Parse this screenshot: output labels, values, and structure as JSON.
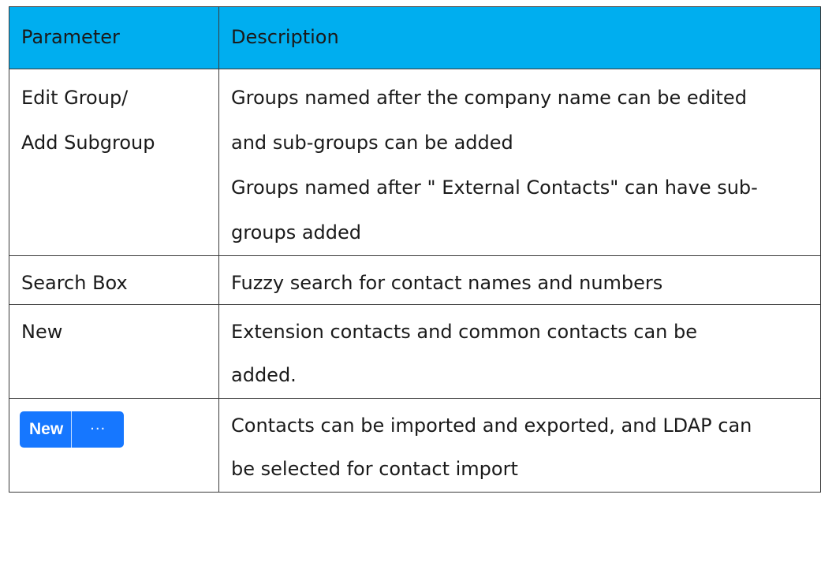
{
  "table": {
    "headers": {
      "parameter": "Parameter",
      "description": "Description"
    },
    "rows": [
      {
        "parameter_lines": [
          "Edit Group/",
          "Add Subgroup"
        ],
        "description_lines": [
          "Groups named after the company name can be edited",
          "and sub-groups can be added",
          "Groups named after \" External Contacts\" can have sub-",
          "groups added"
        ]
      },
      {
        "parameter_lines": [
          "Search Box"
        ],
        "description_lines": [
          "Fuzzy search for contact names and numbers"
        ]
      },
      {
        "parameter_lines": [
          "New"
        ],
        "description_lines": [
          "Extension contacts and common contacts can be",
          "added."
        ]
      },
      {
        "parameter_button": {
          "new_label": "New",
          "more_label": "···",
          "color": "#1677ff"
        },
        "description_lines": [
          "Contacts can be imported and exported, and LDAP can",
          "be selected for contact import"
        ]
      }
    ]
  },
  "colors": {
    "header_background": "#00aeef",
    "border": "#3a3a3a",
    "text": "#1a1a1a"
  }
}
